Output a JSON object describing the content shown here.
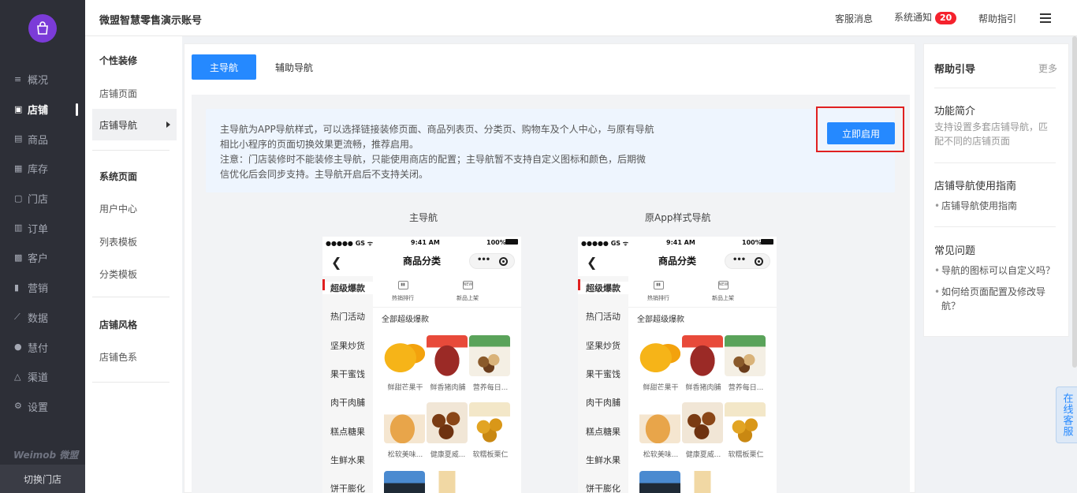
{
  "nav": {
    "items": [
      {
        "label": "概况",
        "icon": "overview-icon"
      },
      {
        "label": "店铺",
        "icon": "store-icon",
        "active": true
      },
      {
        "label": "商品",
        "icon": "goods-icon"
      },
      {
        "label": "库存",
        "icon": "inventory-icon"
      },
      {
        "label": "门店",
        "icon": "shop-icon"
      },
      {
        "label": "订单",
        "icon": "order-icon"
      },
      {
        "label": "客户",
        "icon": "customer-icon"
      },
      {
        "label": "营销",
        "icon": "marketing-icon"
      },
      {
        "label": "数据",
        "icon": "data-icon"
      },
      {
        "label": "慧付",
        "icon": "pay-icon"
      },
      {
        "label": "渠道",
        "icon": "channel-icon"
      },
      {
        "label": "设置",
        "icon": "settings-icon"
      }
    ],
    "brand": "Weimob 微盟",
    "switch_store": "切换门店"
  },
  "topbar": {
    "account": "微盟智慧零售演示账号",
    "service_msg": "客服消息",
    "sys_notice": "系统通知",
    "notice_count": "20",
    "help": "帮助指引"
  },
  "sub": {
    "group1": "个性装修",
    "store_page": "店铺页面",
    "store_nav": "店铺导航",
    "group2": "系统页面",
    "user_center": "用户中心",
    "list_tpl": "列表模板",
    "cat_tpl": "分类模板",
    "group3": "店铺风格",
    "store_color": "店铺色系"
  },
  "main": {
    "tab_main": "主导航",
    "tab_aux": "辅助导航",
    "notice_l1": "主导航为APP导航样式，可以选择链接装修页面、商品列表页、分类页、购物车及个人中心，与原有导航",
    "notice_l2": "相比小程序的页面切换效果更流畅，推荐启用。",
    "notice_l3": "注意：门店装修时不能装修主导航，只能使用商店的配置；主导航暂不支持自定义图标和颜色，后期微",
    "notice_l4": "信优化后会同步支持。主导航开启后不支持关闭。",
    "enable_btn": "立即启用",
    "caption_left": "主导航",
    "caption_right": "原App样式导航"
  },
  "phone": {
    "carrier": "●●●●● GS ᯤ",
    "time": "9:41 AM",
    "battery": "100%",
    "title": "商品分类",
    "categories": [
      "超级爆款",
      "热门活动",
      "坚果炒货",
      "果干蜜饯",
      "肉干肉脯",
      "糕点糖果",
      "生鲜水果",
      "饼干膨化"
    ],
    "icon_hot": "热销排行",
    "icon_new": "新品上架",
    "icon_new_tag": "NEW",
    "all_label": "全部超级爆款",
    "products": [
      "鲜甜芒果干",
      "鲜香猪肉脯",
      "营养每日...",
      "松软美味...",
      "健康夏威...",
      "软糯板栗仁"
    ]
  },
  "help": {
    "title": "帮助引导",
    "more": "更多",
    "sec1": "功能简介",
    "sec1_desc": "支持设置多套店铺导航，匹配不同的店铺页面",
    "sec2": "店铺导航使用指南",
    "sec2_link": "店铺导航使用指南",
    "sec3": "常见问题",
    "faq1": "导航的图标可以自定义吗？",
    "faq2": "如何给页面配置及修改导航？"
  },
  "online_service": "在线客服"
}
